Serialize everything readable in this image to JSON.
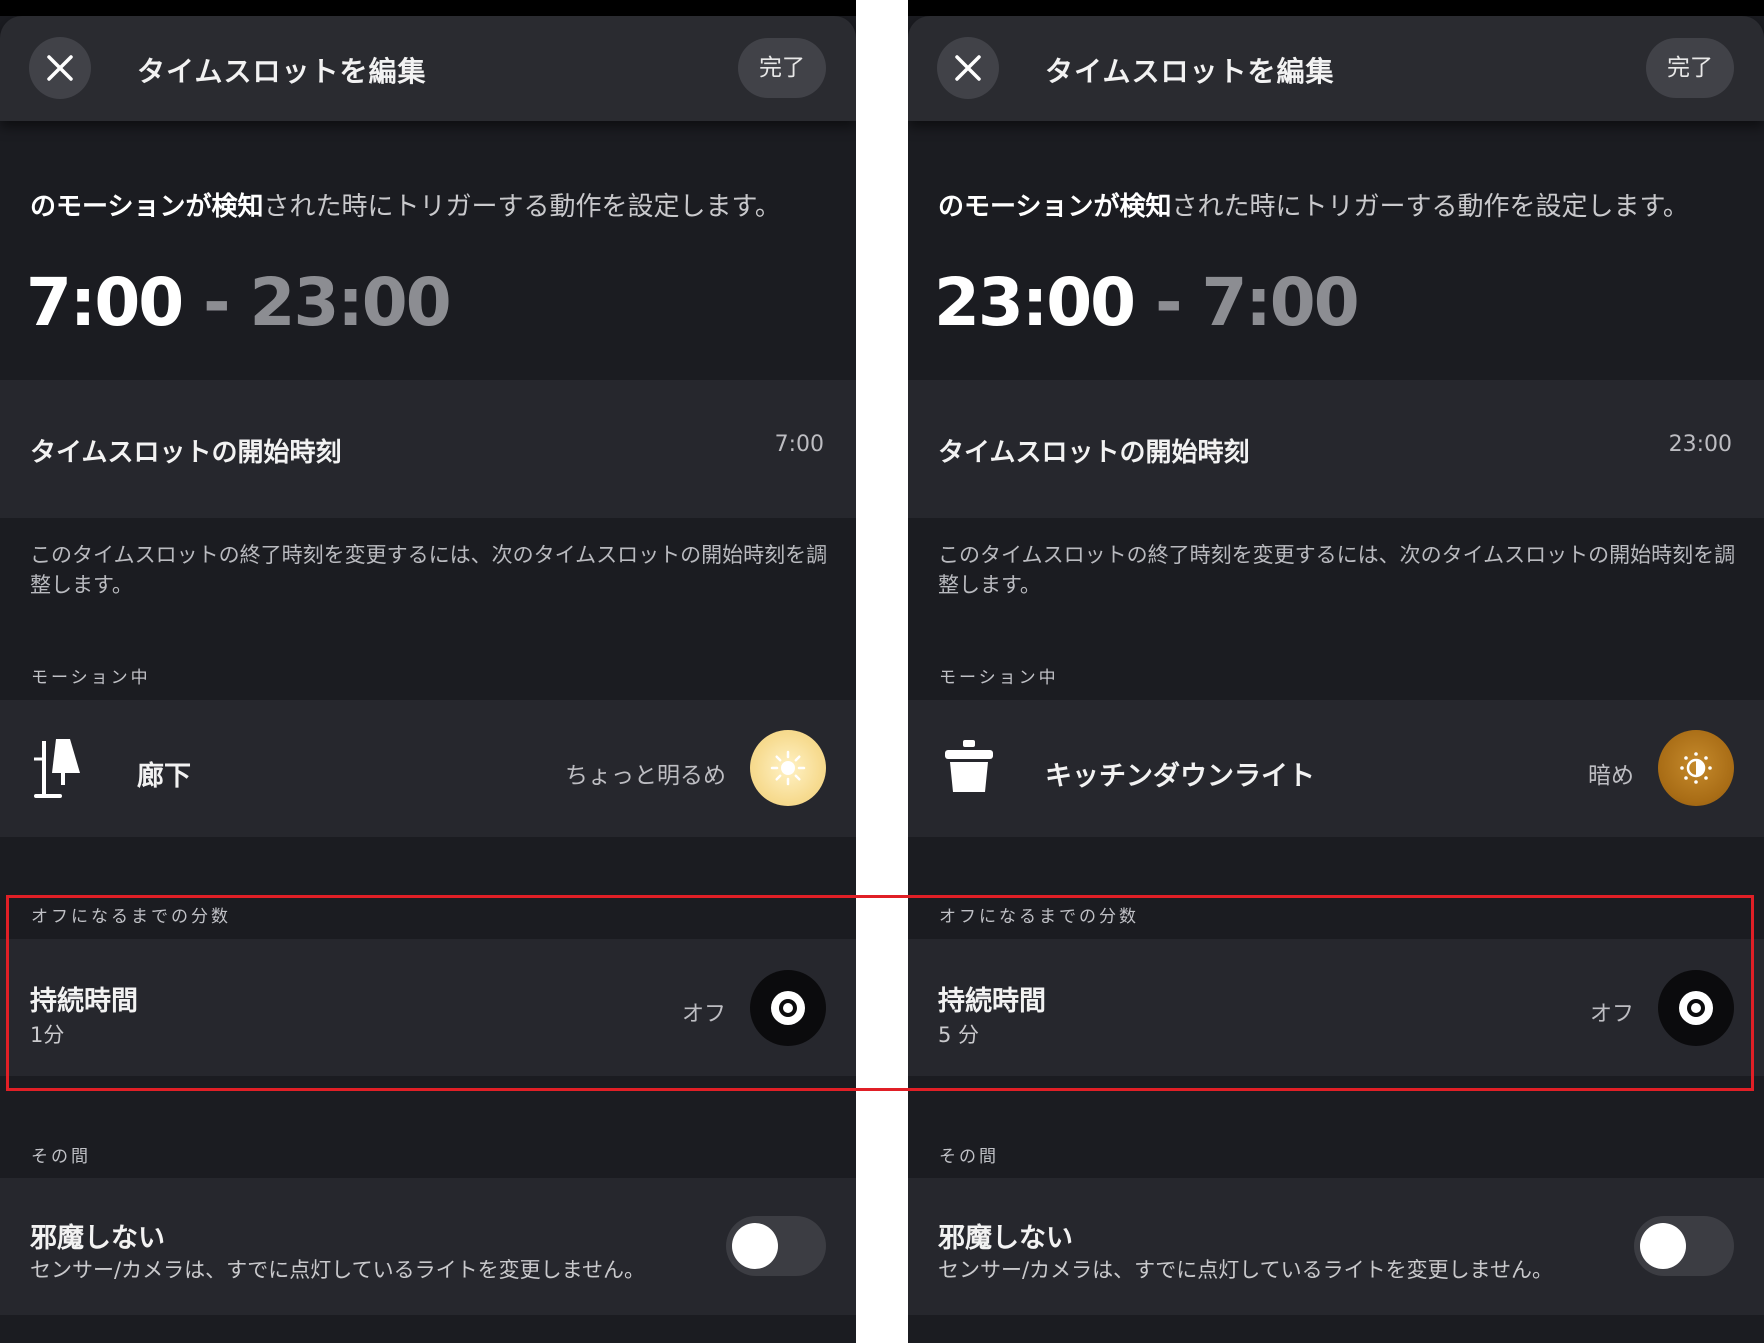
{
  "colors": {
    "panel_bg": "#1b1c21",
    "row_bg": "#26272d",
    "header_bg": "#2a2b30",
    "highlight_border": "#e11f26",
    "bright_light": "#f6d88a",
    "dim_light": "#a86d16"
  },
  "panels": {
    "left": {
      "header": {
        "close_icon": "close-icon",
        "title": "タイムスロットを編集",
        "done_label": "完了"
      },
      "intro": {
        "bold": "のモーションが検知",
        "rest": "された時にトリガーする動作を設定します。"
      },
      "range": {
        "start": "7:00",
        "separator": "-",
        "end": "23:00"
      },
      "start_row": {
        "label": "タイムスロットの開始時刻",
        "value": "7:00"
      },
      "helper_text": "このタイムスロットの終了時刻を変更するには、次のタイムスロットの開始時刻を調整します。",
      "motion_section": "モーション中",
      "light": {
        "icon": "floor-lamp-icon",
        "name": "廊下",
        "state": "ちょっと明るめ",
        "button_icon": "sun-icon"
      },
      "off_section": "オフになるまでの分数",
      "duration": {
        "title": "持続時間",
        "value": "1分",
        "state": "オフ",
        "button_icon": "target-icon"
      },
      "meanwhile_section": "その間",
      "dnd": {
        "title": "邪魔しない",
        "description": "センサー/カメラは、すでに点灯しているライトを変更しません。",
        "enabled": false
      }
    },
    "right": {
      "header": {
        "close_icon": "close-icon",
        "title": "タイムスロットを編集",
        "done_label": "完了"
      },
      "intro": {
        "bold": "のモーションが検知",
        "rest": "された時にトリガーする動作を設定します。"
      },
      "range": {
        "start": "23:00",
        "separator": "-",
        "end": "7:00"
      },
      "start_row": {
        "label": "タイムスロットの開始時刻",
        "value": "23:00"
      },
      "helper_text": "このタイムスロットの終了時刻を変更するには、次のタイムスロットの開始時刻を調整します。",
      "motion_section": "モーション中",
      "light": {
        "icon": "pot-light-icon",
        "name": "キッチンダウンライト",
        "state": "暗め",
        "button_icon": "half-sun-icon"
      },
      "off_section": "オフになるまでの分数",
      "duration": {
        "title": "持続時間",
        "value": "5 分",
        "state": "オフ",
        "button_icon": "target-icon"
      },
      "meanwhile_section": "その間",
      "dnd": {
        "title": "邪魔しない",
        "description": "センサー/カメラは、すでに点灯しているライトを変更しません。",
        "enabled": false
      }
    }
  }
}
